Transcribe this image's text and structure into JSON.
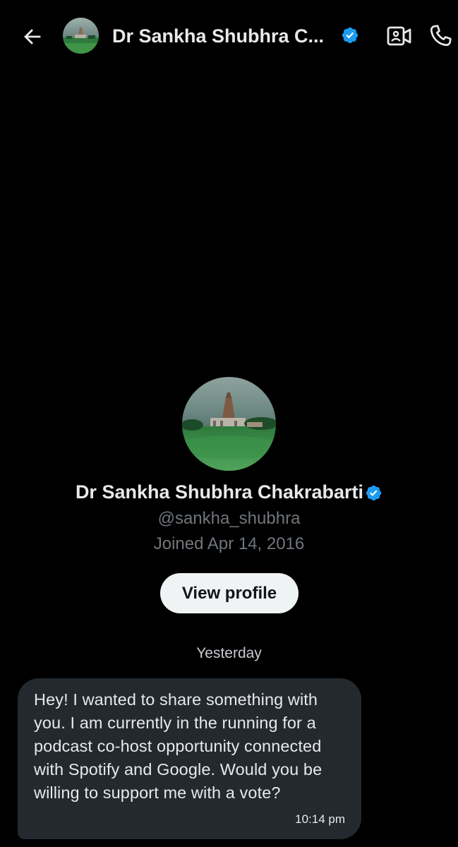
{
  "header": {
    "title": "Dr Sankha Shubhra C...",
    "back_icon": "arrow-left-icon",
    "video_icon": "video-call-icon",
    "call_icon": "phone-call-icon",
    "verified_icon": "verified-badge-icon"
  },
  "profile": {
    "name": "Dr Sankha Shubhra Chakrabarti",
    "handle": "@sankha_shubhra",
    "joined": "Joined Apr 14, 2016",
    "view_profile_label": "View profile"
  },
  "conversation": {
    "date_divider": "Yesterday",
    "messages": [
      {
        "text": "Hey! I wanted to share something with you. I am currently in the running for a podcast co-host opportunity connected with Spotify and Google. Would you be willing to support me with a vote?",
        "time": "10:14 pm"
      }
    ]
  },
  "colors": {
    "background": "#000000",
    "text_primary": "#e7e9ea",
    "text_secondary": "#71767b",
    "verified_blue": "#1d9bf0",
    "bubble": "#23292f",
    "button_bg": "#eff3f4"
  }
}
